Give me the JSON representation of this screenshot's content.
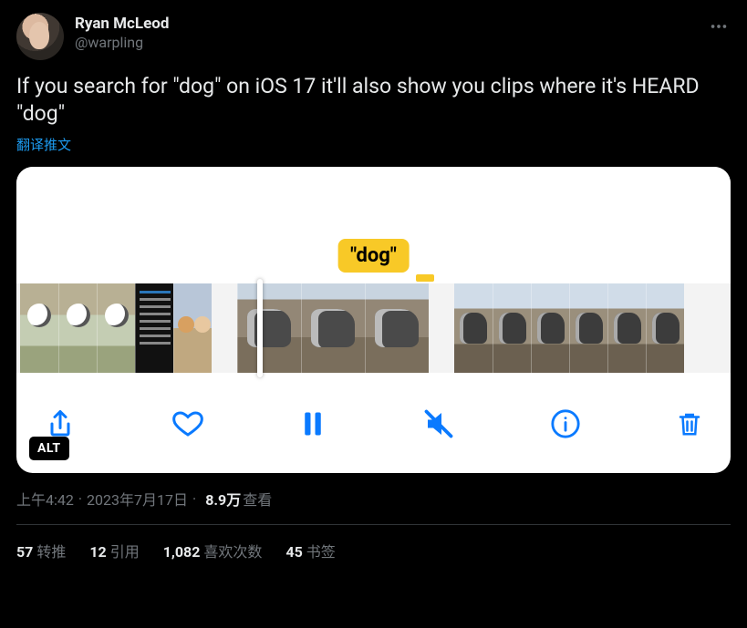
{
  "author": {
    "display_name": "Ryan McLeod",
    "handle": "@warpling"
  },
  "tweet_text": "If you search for \"dog\" on iOS 17 it'll also show you clips where it's HEARD \"dog\"",
  "translate_label": "翻译推文",
  "media": {
    "search_term_label": "\"dog\"",
    "alt_badge": "ALT"
  },
  "meta": {
    "time": "上午4:42",
    "date": "2023年7月17日",
    "views_number": "8.9万",
    "views_label": "查看"
  },
  "stats": {
    "retweets_num": "57",
    "retweets_label": "转推",
    "quotes_num": "12",
    "quotes_label": "引用",
    "likes_num": "1,082",
    "likes_label": "喜欢次数",
    "bookmarks_num": "45",
    "bookmarks_label": "书签"
  }
}
